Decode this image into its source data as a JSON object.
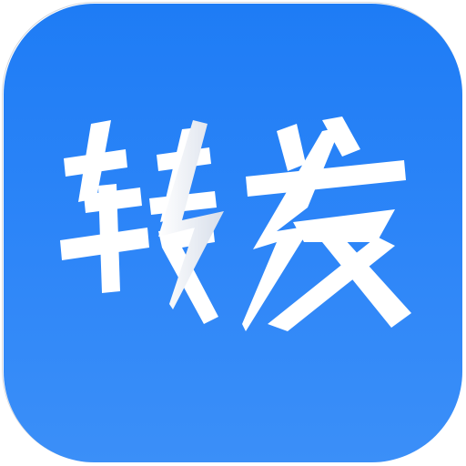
{
  "app_icon": {
    "logo_text": "转发",
    "background_color": "#2b84f7",
    "glyph_color": "#ffffff",
    "accent_shadow_color": "#c9d3e6"
  }
}
